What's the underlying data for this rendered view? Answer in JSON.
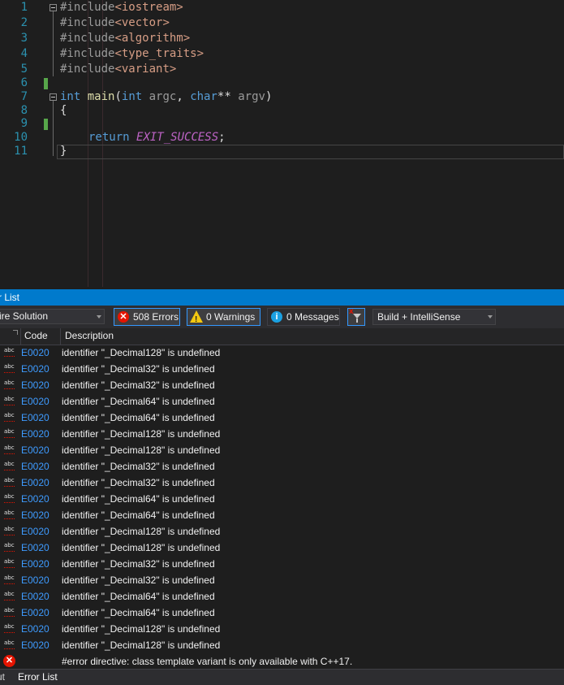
{
  "editor": {
    "line_numbers": [
      "1",
      "2",
      "3",
      "4",
      "5",
      "6",
      "7",
      "8",
      "9",
      "10",
      "11"
    ],
    "code": {
      "l1_pp": "#include",
      "l1_inc": "<iostream>",
      "l2_pp": "#include",
      "l2_inc": "<vector>",
      "l3_pp": "#include",
      "l3_inc": "<algorithm>",
      "l4_pp": "#include",
      "l4_inc": "<type_traits>",
      "l5_pp": "#include",
      "l5_inc": "<variant>",
      "l7_int": "int",
      "l7_main": "main",
      "l7_open": "(",
      "l7_int2": "int",
      "l7_argc": "argc",
      "l7_comma": ", ",
      "l7_char": "char",
      "l7_stars": "**",
      "l7_argv": "argv",
      "l7_close": ")",
      "l8": "{",
      "l10_return": "return",
      "l10_macro": "EXIT_SUCCESS",
      "l10_semi": ";",
      "l11": "}"
    }
  },
  "error_list": {
    "title": "r List",
    "scope_value": "ire Solution",
    "errors_label": "508 Errors",
    "warnings_label": "0 Warnings",
    "messages_label": "0 Messages",
    "source_value": "Build + IntelliSense",
    "columns": {
      "code": "Code",
      "description": "Description"
    },
    "rows": [
      {
        "code": "E0020",
        "desc": "identifier \"_Decimal128\" is undefined"
      },
      {
        "code": "E0020",
        "desc": "identifier \"_Decimal32\" is undefined"
      },
      {
        "code": "E0020",
        "desc": "identifier \"_Decimal32\" is undefined"
      },
      {
        "code": "E0020",
        "desc": "identifier \"_Decimal64\" is undefined"
      },
      {
        "code": "E0020",
        "desc": "identifier \"_Decimal64\" is undefined"
      },
      {
        "code": "E0020",
        "desc": "identifier \"_Decimal128\" is undefined"
      },
      {
        "code": "E0020",
        "desc": "identifier \"_Decimal128\" is undefined"
      },
      {
        "code": "E0020",
        "desc": "identifier \"_Decimal32\" is undefined"
      },
      {
        "code": "E0020",
        "desc": "identifier \"_Decimal32\" is undefined"
      },
      {
        "code": "E0020",
        "desc": "identifier \"_Decimal64\" is undefined"
      },
      {
        "code": "E0020",
        "desc": "identifier \"_Decimal64\" is undefined"
      },
      {
        "code": "E0020",
        "desc": "identifier \"_Decimal128\" is undefined"
      },
      {
        "code": "E0020",
        "desc": "identifier \"_Decimal128\" is undefined"
      },
      {
        "code": "E0020",
        "desc": "identifier \"_Decimal32\" is undefined"
      },
      {
        "code": "E0020",
        "desc": "identifier \"_Decimal32\" is undefined"
      },
      {
        "code": "E0020",
        "desc": "identifier \"_Decimal64\" is undefined"
      },
      {
        "code": "E0020",
        "desc": "identifier \"_Decimal64\" is undefined"
      },
      {
        "code": "E0020",
        "desc": "identifier \"_Decimal128\" is undefined"
      },
      {
        "code": "E0020",
        "desc": "identifier \"_Decimal128\" is undefined"
      }
    ],
    "last_row": {
      "desc": "#error directive: class template variant is only available with C++17."
    }
  },
  "bottom_tabs": {
    "output": "ut",
    "error_list": "Error List"
  },
  "icons": {
    "error": "error-circle-icon",
    "warning": "warning-triangle-icon",
    "info": "info-circle-icon",
    "filter": "filter-clear-icon",
    "intellisense": "intellisense-error-icon"
  },
  "colors": {
    "accent": "#007acc",
    "error": "#e51400",
    "link": "#3e9bff"
  }
}
